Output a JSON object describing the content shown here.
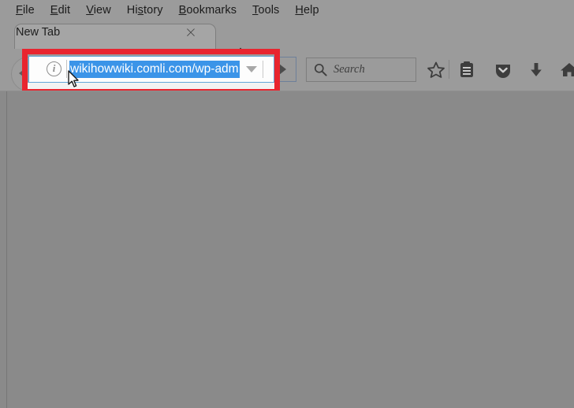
{
  "window": {
    "chrome_color": "#9b9b9b",
    "content_color": "#8a8a8a"
  },
  "menu_bar": {
    "items": [
      {
        "label": "File",
        "accesskey": "F",
        "name": "menu-file"
      },
      {
        "label": "Edit",
        "accesskey": "E",
        "name": "menu-edit"
      },
      {
        "label": "View",
        "accesskey": "V",
        "name": "menu-view"
      },
      {
        "label": "History",
        "accesskey": "s",
        "name": "menu-history"
      },
      {
        "label": "Bookmarks",
        "accesskey": "B",
        "name": "menu-bookmarks"
      },
      {
        "label": "Tools",
        "accesskey": "T",
        "name": "menu-tools"
      },
      {
        "label": "Help",
        "accesskey": "H",
        "name": "menu-help"
      }
    ],
    "file": {
      "pre": "",
      "key": "F",
      "post": "ile"
    },
    "edit": {
      "pre": "",
      "key": "E",
      "post": "dit"
    },
    "view": {
      "pre": "",
      "key": "V",
      "post": "iew"
    },
    "history": {
      "pre": "Hi",
      "key": "s",
      "post": "tory"
    },
    "bookmarks": {
      "pre": "",
      "key": "B",
      "post": "ookmarks"
    },
    "tools": {
      "pre": "",
      "key": "T",
      "post": "ools"
    },
    "help": {
      "pre": "",
      "key": "H",
      "post": "elp"
    }
  },
  "tab_strip": {
    "active_tab_title": "New Tab",
    "close_glyph": "×",
    "new_tab_glyph": "+"
  },
  "toolbar": {
    "back_tooltip": "Back",
    "forward_tooltip": "Forward",
    "url_bar": {
      "value": "wikihowwiki.comli.com/wp-adm",
      "selected": true,
      "selection_color": "#3b94e8",
      "identity_icon_glyph": "i",
      "dropdown_glyph": "▼"
    },
    "search": {
      "placeholder": "Search",
      "icon": "search-icon"
    },
    "icons": [
      {
        "name": "bookmark-star-icon"
      },
      {
        "name": "reader-list-icon"
      },
      {
        "name": "pocket-icon"
      },
      {
        "name": "download-icon"
      },
      {
        "name": "home-icon"
      }
    ]
  },
  "annotation": {
    "highlight_color": "#e8252f",
    "target": "url-bar"
  }
}
